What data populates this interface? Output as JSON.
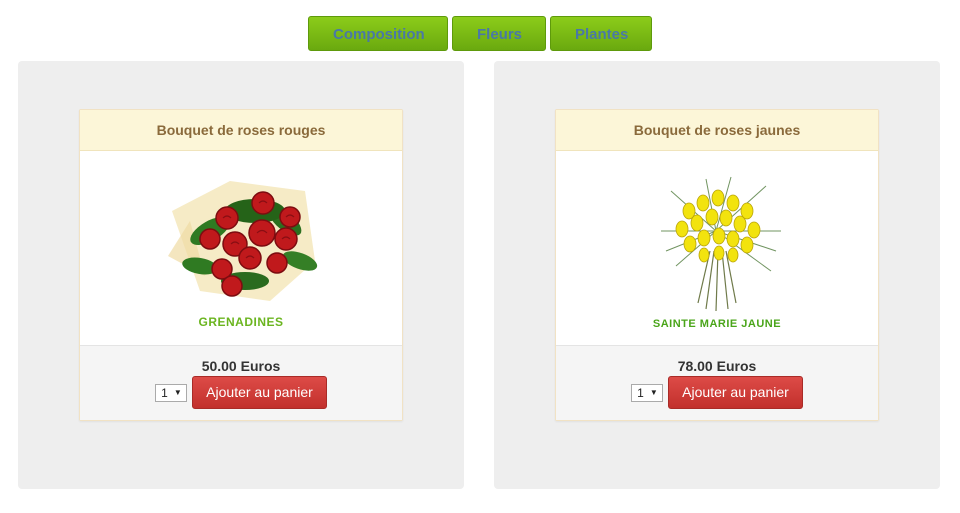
{
  "nav": {
    "tabs": [
      {
        "label": "Composition"
      },
      {
        "label": "Fleurs"
      },
      {
        "label": "Plantes"
      }
    ]
  },
  "products": [
    {
      "title": "Bouquet de roses rouges",
      "image_caption": "GRENADINES",
      "price": "50.00 Euros",
      "quantity": "1",
      "button_label": "Ajouter au panier"
    },
    {
      "title": "Bouquet de roses jaunes",
      "image_caption": "SAINTE MARIE JAUNE",
      "price": "78.00 Euros",
      "quantity": "1",
      "button_label": "Ajouter au panier"
    }
  ],
  "colors": {
    "tab_bg": "#7cbc16",
    "tab_text": "#4a78a6",
    "panel_bg": "#eeeeee",
    "card_header_bg": "#fcf6d8",
    "card_header_text": "#8a6a3b",
    "button_bg": "#d13f3b"
  }
}
